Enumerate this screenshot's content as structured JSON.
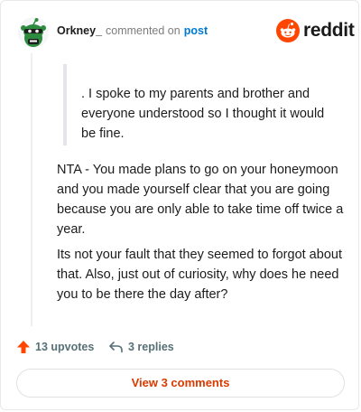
{
  "header": {
    "username": "Orkney_",
    "action_text": "commented on",
    "post_link_label": "post",
    "logo_text": "reddit",
    "avatar_icon": "snoo-avatar-icon",
    "logo_icon": "reddit-snoo-icon"
  },
  "comment": {
    "quote": ". I spoke to my parents and brother and everyone understood so I thought it would be fine.",
    "paragraphs": [
      "NTA - You made plans to go on your honeymoon and you made yourself clear that you are going because you are only able to take time off twice a year.",
      "Its not your fault that they seemed to forgot about that. Also, just out of curiosity, why does he need you to be there the day after?"
    ]
  },
  "actions": {
    "upvotes_label": "13 upvotes",
    "replies_label": "3 replies",
    "upvote_icon": "upvote-arrow-icon",
    "reply_icon": "reply-arrow-icon"
  },
  "footer": {
    "view_comments_label": "View 3 comments"
  },
  "colors": {
    "accent_orange": "#d93a00",
    "reddit_orange": "#ff4500",
    "link_blue": "#0079d3",
    "upvote_red": "#ff4500",
    "avatar_green": "#2d8a3e",
    "muted_text": "#576f76"
  }
}
